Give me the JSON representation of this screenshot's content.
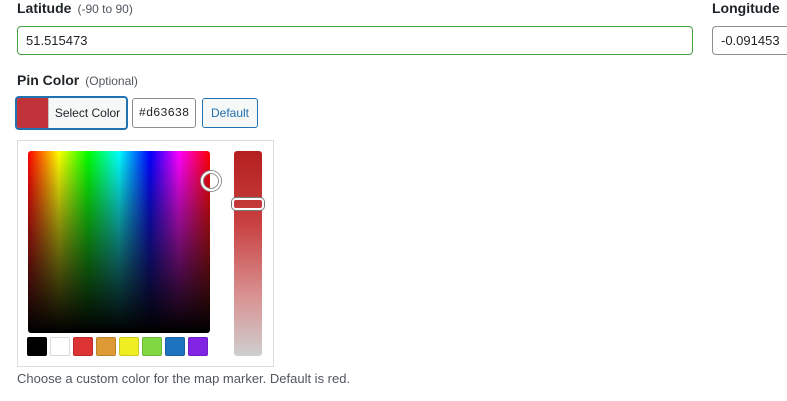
{
  "latitude": {
    "label": "Latitude",
    "hint": "(-90 to 90)",
    "value": "51.515473"
  },
  "longitude": {
    "label": "Longitude",
    "value": "-0.091453"
  },
  "pin_color": {
    "label": "Pin Color",
    "hint": "(Optional)",
    "select_label": "Select Color",
    "hex_value": "#d63638",
    "default_label": "Default",
    "help_text": "Choose a custom color for the map marker. Default is red."
  },
  "colors": {
    "current": "#c0333a",
    "accent": "#2271b1",
    "input_border": "#46a046"
  },
  "palette": [
    {
      "name": "black",
      "hex": "#000000"
    },
    {
      "name": "white",
      "hex": "#ffffff"
    },
    {
      "name": "red",
      "hex": "#dd3333"
    },
    {
      "name": "orange",
      "hex": "#dd9933"
    },
    {
      "name": "yellow",
      "hex": "#eeee22"
    },
    {
      "name": "green",
      "hex": "#81d742"
    },
    {
      "name": "blue",
      "hex": "#1e73be"
    },
    {
      "name": "purple",
      "hex": "#8224e3"
    }
  ]
}
